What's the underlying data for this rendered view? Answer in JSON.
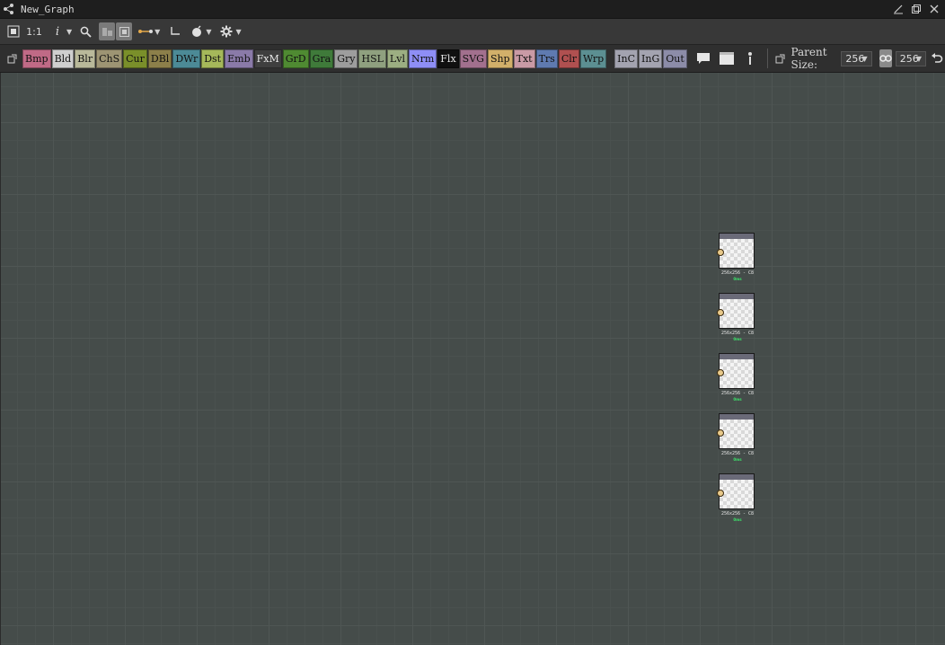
{
  "window": {
    "title": "New_Graph"
  },
  "toolbar1": {
    "zoom_label": "1:1",
    "info_label": "i"
  },
  "node_buttons": [
    {
      "label": "Bmp",
      "color": "#c06a86"
    },
    {
      "label": "Bld",
      "color": "#cfcfcf"
    },
    {
      "label": "Blr",
      "color": "#b9b99a"
    },
    {
      "label": "ChS",
      "color": "#9d9473"
    },
    {
      "label": "Cur",
      "color": "#7a8f2a"
    },
    {
      "label": "DBl",
      "color": "#8c7f4a"
    },
    {
      "label": "DWr",
      "color": "#4c8a96"
    },
    {
      "label": "Dst",
      "color": "#a5b85a"
    },
    {
      "label": "Emb",
      "color": "#8a7aa8"
    },
    {
      "label": "FxM",
      "color": "#3f3f3f"
    },
    {
      "label": "GrD",
      "color": "#4f8a32"
    },
    {
      "label": "Gra",
      "color": "#3f7a3a"
    },
    {
      "label": "Gry",
      "color": "#9d9d9d"
    },
    {
      "label": "HSL",
      "color": "#8fa07f"
    },
    {
      "label": "Lvl",
      "color": "#9cae82"
    },
    {
      "label": "Nrm",
      "color": "#8e8ef5"
    },
    {
      "label": "Flx",
      "color": "#101010"
    },
    {
      "label": "SVG",
      "color": "#a2708e"
    },
    {
      "label": "Shp",
      "color": "#d2b06a"
    },
    {
      "label": "Txt",
      "color": "#c99aa5"
    },
    {
      "label": "Trs",
      "color": "#5f7ab0"
    },
    {
      "label": "Clr",
      "color": "#b05050"
    },
    {
      "label": "Wrp",
      "color": "#5c8f92"
    },
    {
      "label": "InC",
      "color": "#a3a3b0"
    },
    {
      "label": "InG",
      "color": "#a3a3b0"
    },
    {
      "label": "Out",
      "color": "#8c8ca8"
    }
  ],
  "parent_size": {
    "label": "Parent Size:",
    "width_value": "256",
    "height_value": "256"
  },
  "nodes": [
    {
      "label": "256x256 - C8",
      "status": "0ms"
    },
    {
      "label": "256x256 - C8",
      "status": "0ms"
    },
    {
      "label": "256x256 - C8",
      "status": "0ms"
    },
    {
      "label": "256x256 - C8",
      "status": "0ms"
    },
    {
      "label": "256x256 - C8",
      "status": "0ms"
    }
  ],
  "icons": {
    "graph": "graph-icon",
    "pin": "pin-icon",
    "restore": "restore-icon",
    "close": "close-icon",
    "fit": "fit-view-icon",
    "search": "search-icon",
    "align": "align-icon",
    "connector": "connector-icon",
    "frame": "frame-icon",
    "bomb": "bomb-icon",
    "settings": "gear-icon",
    "comment": "comment-icon",
    "panel": "panel-icon",
    "pin_dot": "pin-dot-icon",
    "popout": "popout-icon",
    "link": "link-icon",
    "undo": "undo-icon"
  }
}
